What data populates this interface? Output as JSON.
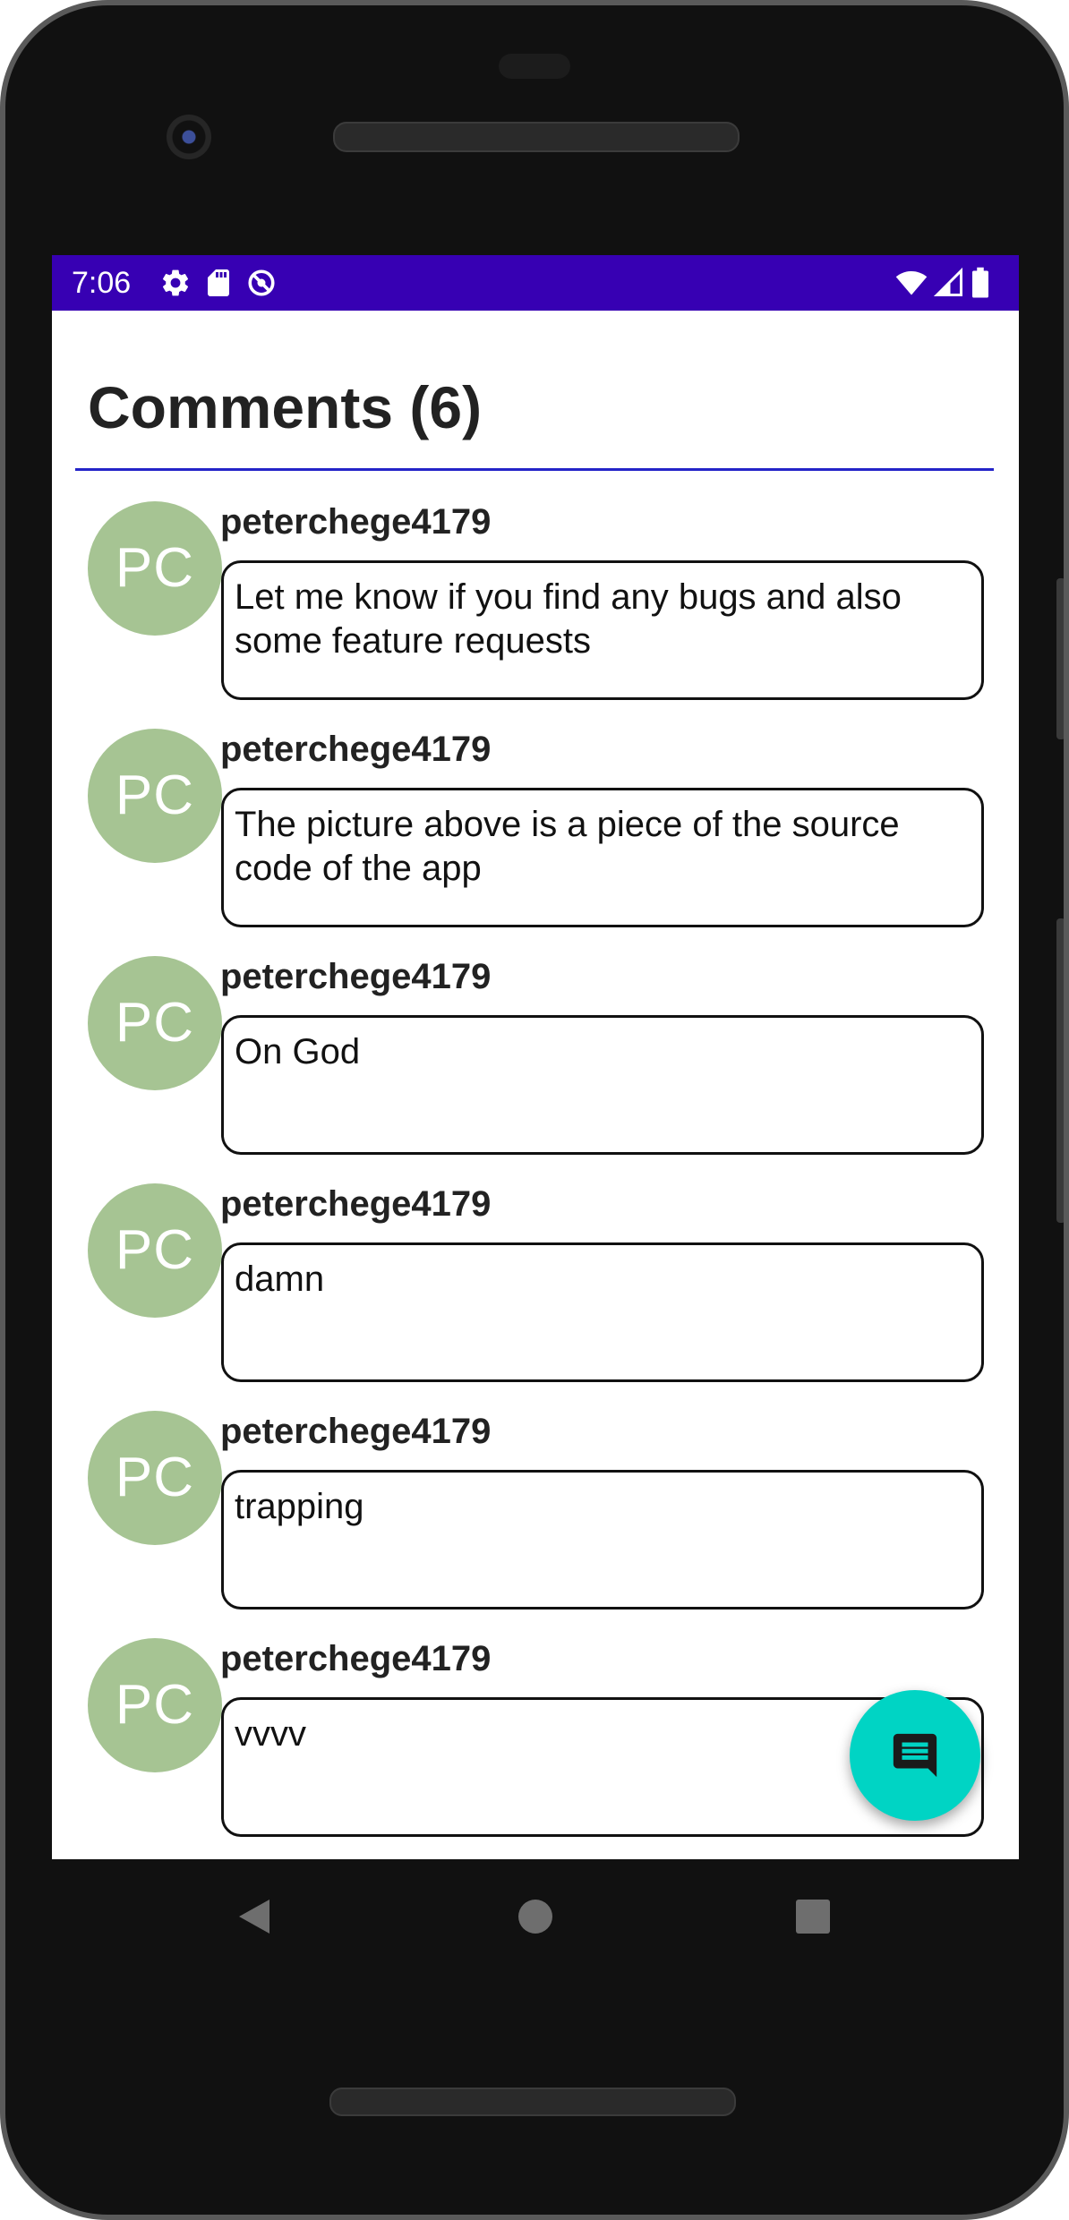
{
  "status_bar": {
    "time": "7:06",
    "left_icons": [
      "settings-icon",
      "sd-card-icon",
      "no-sync-icon"
    ],
    "right_icons": [
      "wifi-icon",
      "cell-signal-icon",
      "battery-icon"
    ],
    "background_color": "#3700b3"
  },
  "header": {
    "title": "Comments (6)",
    "divider_color": "#2424c8"
  },
  "comments": [
    {
      "avatar_initials": "PC",
      "username": "peterchege4179",
      "text": "Let me know if you find any bugs and also some feature requests"
    },
    {
      "avatar_initials": "PC",
      "username": "peterchege4179",
      "text": "The picture above is a piece of the source code of the app"
    },
    {
      "avatar_initials": "PC",
      "username": "peterchege4179",
      "text": "On God"
    },
    {
      "avatar_initials": "PC",
      "username": "peterchege4179",
      "text": "damn"
    },
    {
      "avatar_initials": "PC",
      "username": "peterchege4179",
      "text": "trapping"
    },
    {
      "avatar_initials": "PC",
      "username": "peterchege4179",
      "text": "vvvv"
    }
  ],
  "fab": {
    "icon": "comment-icon",
    "color": "#00d4c4"
  },
  "navigation": {
    "buttons": [
      "back-icon",
      "home-icon",
      "recents-icon"
    ]
  },
  "colors": {
    "avatar": "#a6c493"
  }
}
